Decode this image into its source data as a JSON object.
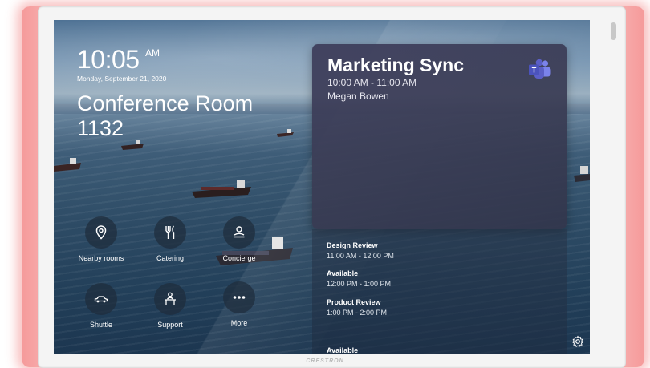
{
  "device": {
    "brand": "CRESTRON"
  },
  "clock": {
    "time": "10:05",
    "ampm": "AM",
    "date": "Monday, September 21, 2020"
  },
  "room": {
    "name": "Conference Room 1132"
  },
  "actions": [
    {
      "label": "Nearby rooms",
      "icon": "location-pin-icon"
    },
    {
      "label": "Catering",
      "icon": "utensils-icon"
    },
    {
      "label": "Concierge",
      "icon": "concierge-icon"
    },
    {
      "label": "Shuttle",
      "icon": "car-icon"
    },
    {
      "label": "Support",
      "icon": "support-desk-icon"
    },
    {
      "label": "More",
      "icon": "more-dots-icon"
    }
  ],
  "current_meeting": {
    "title": "Marketing Sync",
    "time": "10:00 AM - 11:00 AM",
    "organizer": "Megan Bowen",
    "app_icon": "microsoft-teams-icon",
    "app_icon_letter": "T"
  },
  "schedule": [
    {
      "name": "Design Review",
      "range": "11:00 AM - 12:00 PM"
    },
    {
      "name": "Available",
      "range": "12:00 PM - 1:00 PM"
    },
    {
      "name": "Product Review",
      "range": "1:00 PM - 2:00 PM"
    },
    {
      "name": "Available",
      "range": ""
    }
  ],
  "settings": {
    "icon": "gear-icon"
  },
  "colors": {
    "accent_glow": "#f06e6e",
    "teams_purple": "#5b5fc7"
  }
}
